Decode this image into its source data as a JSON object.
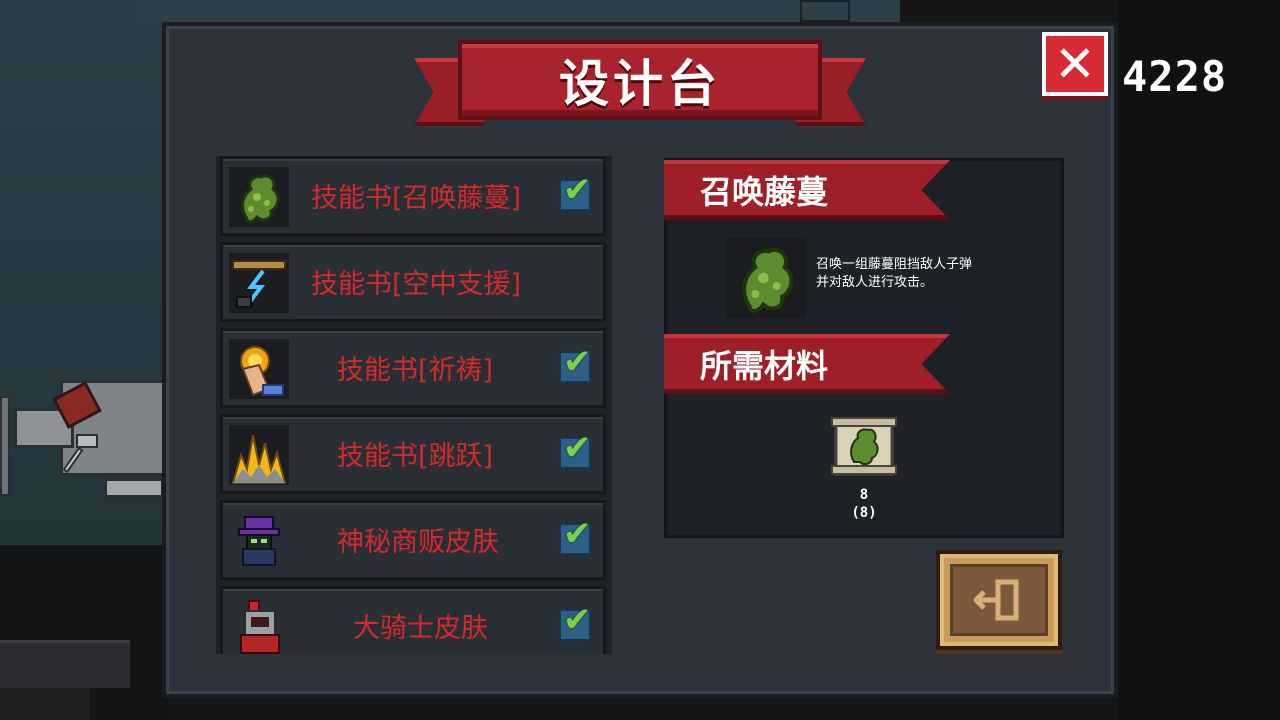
{
  "title": "设计台",
  "coins": "4228",
  "items": [
    {
      "label": "技能书[召唤藤蔓]",
      "icon": "vine-icon",
      "checked": true,
      "selected": true
    },
    {
      "label": "技能书[空中支援]",
      "icon": "air-support-icon",
      "checked": false,
      "selected": false
    },
    {
      "label": "技能书[祈祷]",
      "icon": "prayer-icon",
      "checked": true,
      "selected": false
    },
    {
      "label": "技能书[跳跃]",
      "icon": "jump-icon",
      "checked": true,
      "selected": false
    },
    {
      "label": "神秘商贩皮肤",
      "icon": "mysterious-merchant-icon",
      "checked": true,
      "selected": false
    },
    {
      "label": "大骑士皮肤",
      "icon": "grand-knight-icon",
      "checked": true,
      "selected": false
    }
  ],
  "detail": {
    "name": "召唤藤蔓",
    "description_line1": "召唤一组藤蔓阻挡敌人子弹",
    "description_line2": "并对敌人进行攻击。",
    "materials_title": "所需材料",
    "material_icon": "vine-scroll-icon",
    "material_count": "8",
    "material_owned": "(8)"
  },
  "colors": {
    "accent_red": "#a8232c",
    "item_text": "#d42a2a",
    "check_green": "#79d24a",
    "exit_brown": "#c99a5a"
  }
}
